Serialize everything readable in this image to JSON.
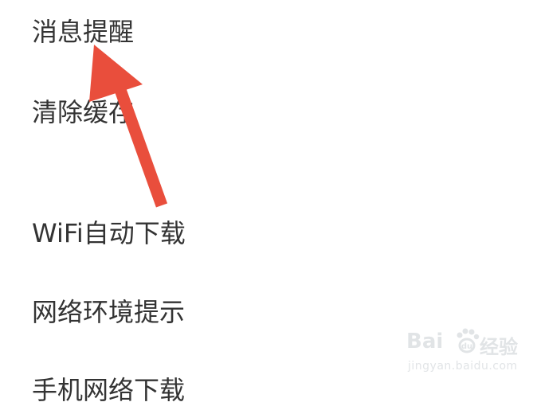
{
  "settings": {
    "items": [
      {
        "label": "消息提醒"
      },
      {
        "label": "清除缓存"
      },
      {
        "label": "WiFi自动下载"
      },
      {
        "label": "网络环境提示"
      },
      {
        "label": "手机网络下载"
      }
    ]
  },
  "watermark": {
    "logo_text": "Bai  ",
    "site_name": "经验",
    "url": "jingyan.baidu.com"
  },
  "annotation": {
    "arrow_color": "#e94e3c"
  }
}
